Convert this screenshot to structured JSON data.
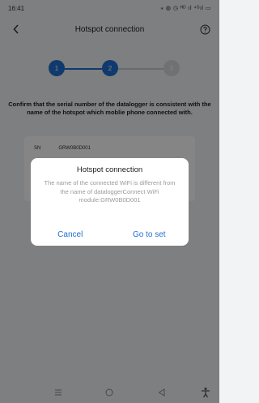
{
  "status_bar": {
    "time": "16:41",
    "icons": "⁎ ◍ ◷ ᴴᴰ ıl ⁴ᴳıl ▭"
  },
  "nav": {
    "title": "Hotspot connection"
  },
  "steps": [
    {
      "label": "1",
      "state": "done"
    },
    {
      "label": "2",
      "state": "active"
    },
    {
      "label": "3",
      "state": "pending"
    }
  ],
  "instruction": "Confirm that the serial number of the datalogger is consistent with the name of the hotspot which moblie phone connected with.",
  "card": {
    "sn_label": "SN",
    "sn_value": "GRW0B0D001"
  },
  "dialog": {
    "title": "Hotspot connection",
    "message": "The name of the connected WiFi is different from the name of dataloggerConnect WiFi module:GRW0B0D001",
    "cancel": "Cancel",
    "confirm": "Go to set"
  },
  "colors": {
    "accent": "#1f6fd1",
    "overlay": "rgba(0,0,0,0.48)"
  }
}
